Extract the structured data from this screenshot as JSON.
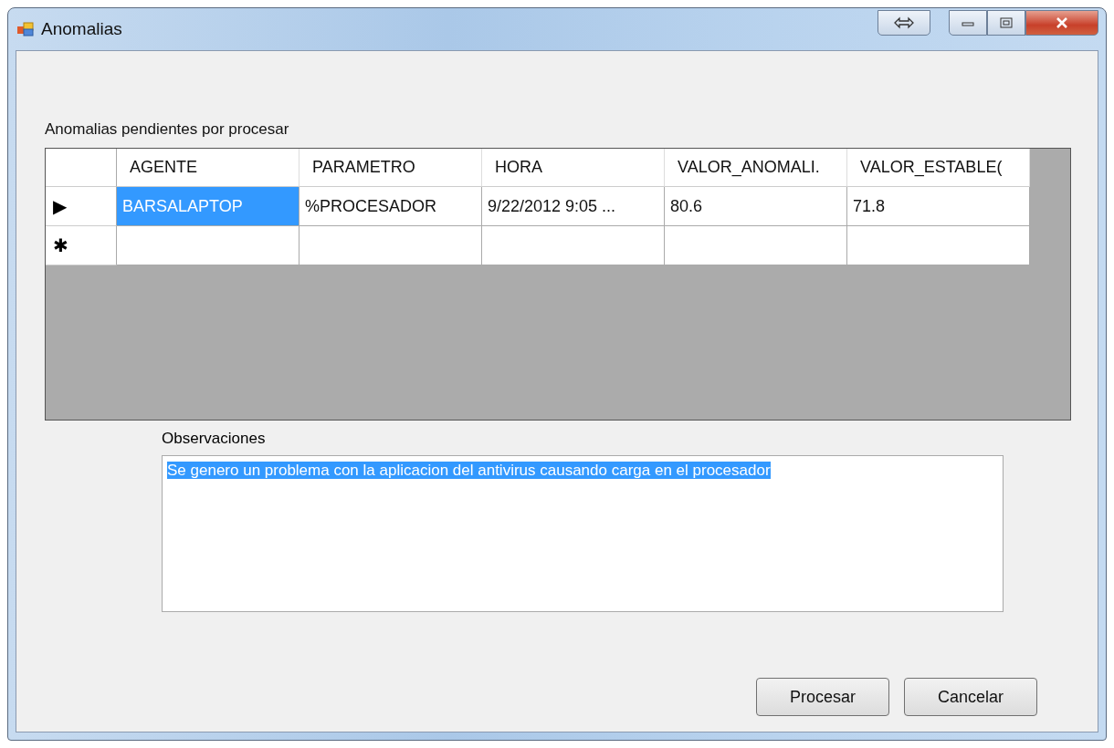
{
  "window": {
    "title": "Anomalias"
  },
  "grid": {
    "label": "Anomalias pendientes por procesar",
    "columns": [
      "AGENTE",
      "PARAMETRO",
      "HORA",
      "VALOR_ANOMALI.",
      "VALOR_ESTABLE("
    ],
    "rows": [
      {
        "marker": "▶",
        "selected": true,
        "cells": [
          "BARSALAPTOP",
          "%PROCESADOR",
          "9/22/2012 9:05 ...",
          "80.6",
          "71.8"
        ]
      },
      {
        "marker": "✱",
        "selected": false,
        "cells": [
          "",
          "",
          "",
          "",
          ""
        ]
      }
    ]
  },
  "observations": {
    "label": "Observaciones",
    "value": "Se genero un problema con la aplicacion del antivirus causando carga en el procesador",
    "text_selected": true
  },
  "buttons": [
    "Procesar",
    "Cancelar"
  ]
}
